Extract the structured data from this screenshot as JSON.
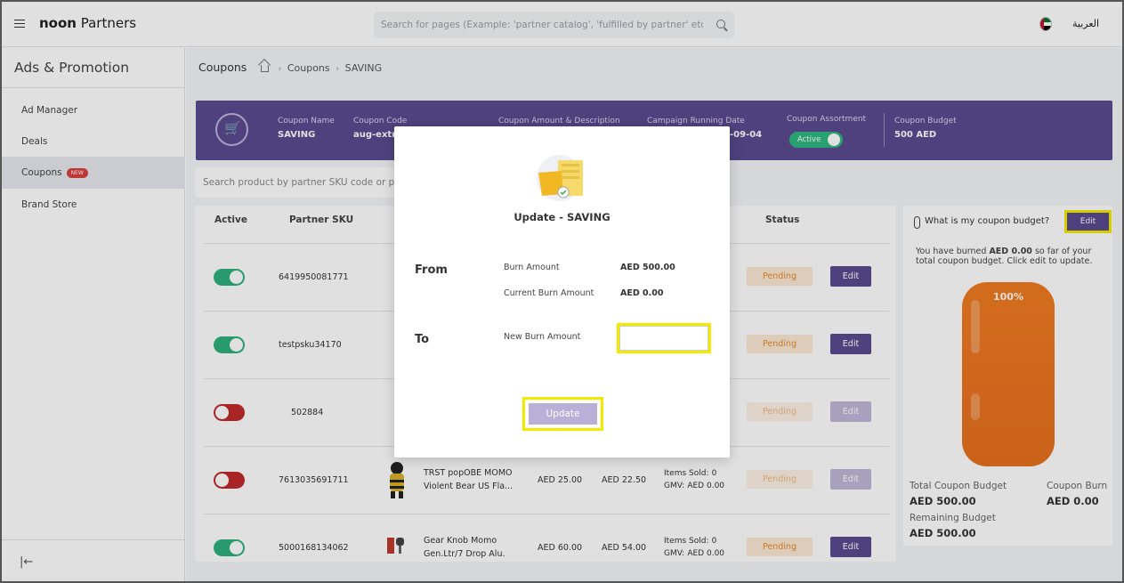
{
  "brand": {
    "bold": "noon",
    "rest": " Partners"
  },
  "search": {
    "placeholder": "Search for pages (Example: 'partner catalog', 'fulfilled by partner' etc)"
  },
  "lang": "العربية",
  "sidebar": {
    "title": "Ads & Promotion",
    "items": [
      {
        "label": "Ad Manager"
      },
      {
        "label": "Deals"
      },
      {
        "label": "Coupons",
        "badge": "NEW"
      },
      {
        "label": "Brand Store"
      }
    ]
  },
  "breadcrumb": {
    "title": "Coupons",
    "parent": "Coupons",
    "current": "SAVING"
  },
  "coupon_header": {
    "name_label": "Coupon Name",
    "name_value": "SAVING",
    "code_label": "Coupon Code",
    "code_value": "aug-extra",
    "amount_label": "Coupon Amount & Description",
    "date_label": "Campaign Running Date",
    "date_value": "-09-04",
    "assortment_label": "Coupon Assortment",
    "assortment_value": "Active",
    "budget_label": "Coupon Budget",
    "budget_value": "500 AED"
  },
  "sku_search": {
    "placeholder": "Search product by partner SKU code or prod"
  },
  "table": {
    "headers": {
      "active": "Active",
      "sku": "Partner SKU",
      "status": "Status"
    },
    "rows": [
      {
        "active": true,
        "sku": "6419950081771",
        "status": "Pending",
        "edit": "Edit",
        "edit_enabled": true
      },
      {
        "active": true,
        "sku": "testpsku34170",
        "status": "Pending",
        "edit": "Edit",
        "edit_enabled": true
      },
      {
        "active": false,
        "sku": "502884",
        "status": "Pending",
        "edit": "Edit",
        "edit_enabled": false
      },
      {
        "active": false,
        "sku": "7613035691711",
        "name1": "TRST popOBE MOMO",
        "name2": "Violent Bear US Fla...",
        "price": "AED 25.00",
        "sale": "AED 22.50",
        "sold_label": "Items Sold:",
        "sold_val": "0",
        "gmv_label": "GMV:",
        "gmv_val": "AED 0.00",
        "status": "Pending",
        "edit": "Edit",
        "edit_enabled": false
      },
      {
        "active": true,
        "sku": "5000168134062",
        "name1": "Gear Knob Momo",
        "name2": "Gen.Ltr/7 Drop Alu.",
        "price": "AED 60.00",
        "sale": "AED 54.00",
        "sold_label": "Items Sold:",
        "sold_val": "0",
        "gmv_label": "GMV:",
        "gmv_val": "AED 0.00",
        "status": "Pending",
        "edit": "Edit",
        "edit_enabled": true
      }
    ]
  },
  "budget": {
    "question": "What is my coupon budget?",
    "edit": "Edit",
    "burned_pre": "You have burned ",
    "burned_amount": "AED 0.00",
    "burned_post": " so far of your total coupon budget. Click edit to update.",
    "percent": "100%",
    "total_label": "Total Coupon Budget",
    "total_value": "AED 500.00",
    "burn_label": "Coupon Burn",
    "burn_value": "AED 0.00",
    "remaining_label": "Remaining Budget",
    "remaining_value": "AED 500.00"
  },
  "modal": {
    "title": "Update - SAVING",
    "from_label": "From",
    "burn_amount_label": "Burn Amount",
    "burn_amount_value": "AED 500.00",
    "current_burn_label": "Current Burn Amount",
    "current_burn_value": "AED 0.00",
    "to_label": "To",
    "new_burn_label": "New Burn Amount",
    "new_burn_value": "",
    "update_button": "Update"
  },
  "colors": {
    "accent": "#5b4b8f",
    "toggle_on": "#2eb07d",
    "toggle_off": "#c0292b",
    "pending": "#e88a2b",
    "highlight": "#f4ea00"
  }
}
